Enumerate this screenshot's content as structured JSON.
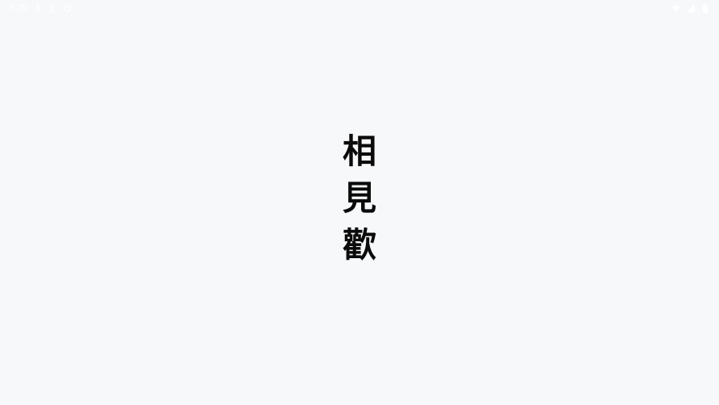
{
  "status_bar": {
    "time": "5:20",
    "left_icons": [
      "download-icon",
      "download-icon",
      "notification-icon"
    ],
    "right_icons": [
      "wifi-icon",
      "signal-icon",
      "battery-icon"
    ]
  },
  "splash": {
    "chars": [
      "相",
      "見",
      "歡"
    ]
  },
  "colors": {
    "background": "#f7f8fa",
    "text": "#0b0b0b"
  }
}
